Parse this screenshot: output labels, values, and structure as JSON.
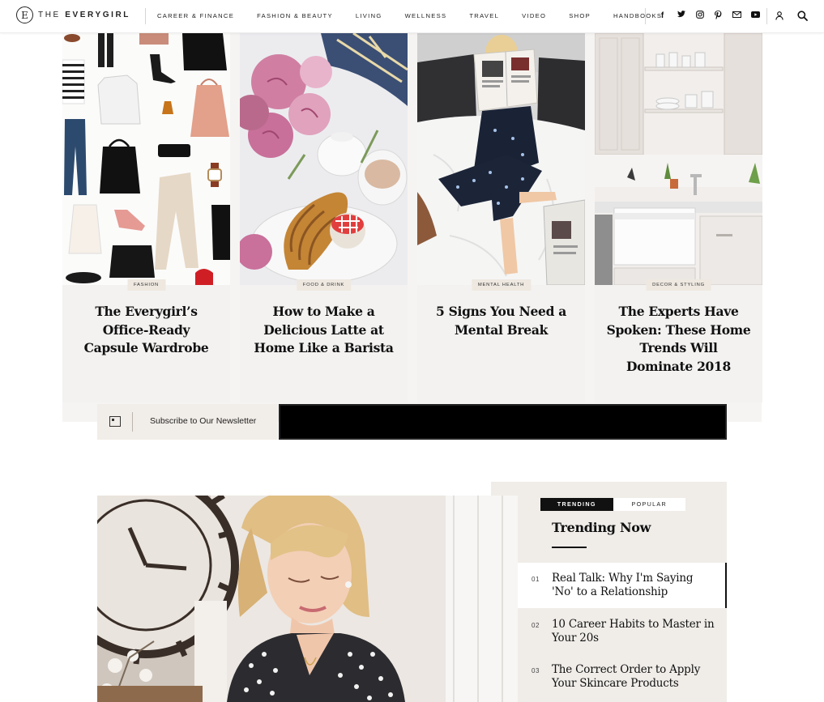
{
  "header": {
    "logo_mark": "E",
    "logo_prefix": "THE",
    "logo_name": "EVERYGIRL",
    "nav": [
      "CAREER & FINANCE",
      "FASHION & BEAUTY",
      "LIVING",
      "WELLNESS",
      "TRAVEL",
      "VIDEO",
      "SHOP",
      "HANDBOOKS"
    ],
    "social": [
      {
        "icon": "facebook-icon",
        "glyph": "f"
      },
      {
        "icon": "twitter-icon",
        "glyph": "t"
      },
      {
        "icon": "instagram-icon",
        "glyph": "◎"
      },
      {
        "icon": "pinterest-icon",
        "glyph": "p"
      },
      {
        "icon": "email-icon",
        "glyph": "✉"
      },
      {
        "icon": "youtube-icon",
        "glyph": "▶"
      }
    ]
  },
  "cards": [
    {
      "tag": "FASHION",
      "title": "The Everygirl’s Office-Ready Capsule Wardrobe"
    },
    {
      "tag": "FOOD & DRINK",
      "title": "How to Make a Delicious Latte at Home Like a Barista"
    },
    {
      "tag": "MENTAL HEALTH",
      "title": "5 Signs You Need a Mental Break"
    },
    {
      "tag": "DECOR & STYLING",
      "title": "The Experts Have Spoken: These Home Trends Will Dominate 2018"
    }
  ],
  "newsletter": {
    "label": "Subscribe to Our Newsletter",
    "placeholder": ""
  },
  "trending": {
    "tabs": [
      "TRENDING",
      "POPULAR"
    ],
    "active_tab": "TRENDING",
    "title": "Trending Now",
    "items": [
      {
        "num": "01",
        "text": "Real Talk: Why I'm Saying 'No' to a Relationship"
      },
      {
        "num": "02",
        "text": "10 Career Habits to Master in Your 20s"
      },
      {
        "num": "03",
        "text": "The Correct Order to Apply Your Skincare Products"
      }
    ]
  },
  "colors": {
    "accent": "#111111",
    "tag_bg": "#eee8e0",
    "panel_bg": "#f0ede9"
  }
}
